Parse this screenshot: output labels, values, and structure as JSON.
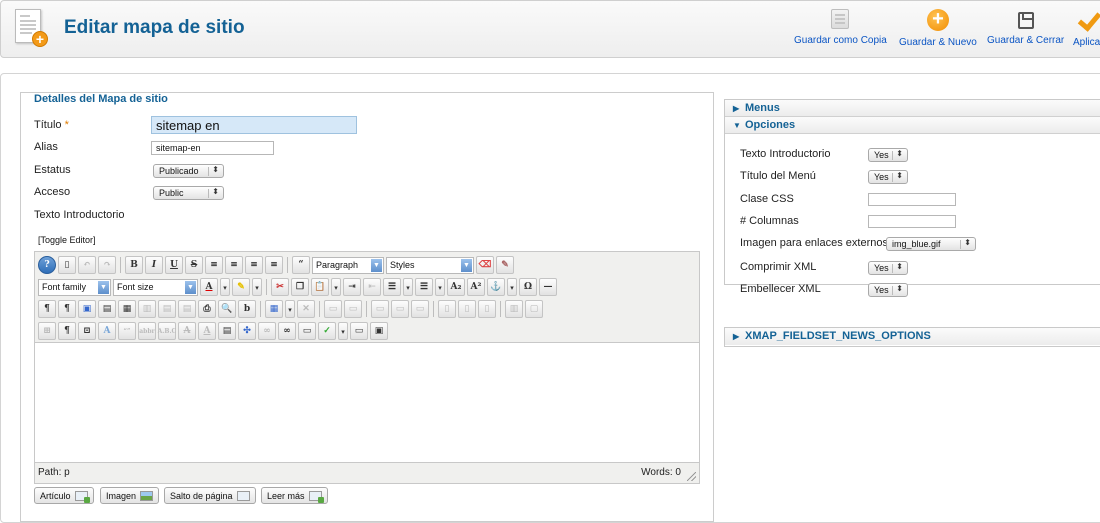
{
  "header": {
    "title": "Editar mapa de sitio",
    "buttons": [
      {
        "label": "Guardar como Copia",
        "icon": "copy-icon"
      },
      {
        "label": "Guardar & Nuevo",
        "icon": "plus-circle-icon"
      },
      {
        "label": "Guardar & Cerrar",
        "icon": "floppy-icon"
      },
      {
        "label": "Aplicar",
        "icon": "check-icon"
      }
    ]
  },
  "details": {
    "legend": "Detalles del Mapa de sitio",
    "title_label": "Título",
    "required_mark": "*",
    "title_value": "sitemap en",
    "alias_label": "Alias",
    "alias_value": "sitemap-en",
    "status_label": "Estatus",
    "status_value": "Publicado",
    "access_label": "Acceso",
    "access_value": "Public",
    "intro_label": "Texto Introductorio",
    "toggle_editor": "[Toggle Editor]"
  },
  "editor": {
    "format_select": "Paragraph",
    "styles_select": "Styles",
    "font_family_select": "Font family",
    "font_size_select": "Font size",
    "path_label": "Path: p",
    "words_label": "Words: 0"
  },
  "extra_buttons": [
    "Artículo",
    "Imagen",
    "Salto de página",
    "Leer más"
  ],
  "sidebar": {
    "menus_title": "Menus",
    "options_title": "Opciones",
    "news_title": "XMAP_FIELDSET_NEWS_OPTIONS",
    "options": {
      "intro_text_label": "Texto Introductorio",
      "intro_text_value": "Yes",
      "menu_title_label": "Título del Menú",
      "menu_title_value": "Yes",
      "css_class_label": "Clase CSS",
      "columns_label": "# Columnas",
      "external_image_label": "Imagen para enlaces externos",
      "external_image_value": "img_blue.gif",
      "compress_label": "Comprimir XML",
      "compress_value": "Yes",
      "beautify_label": "Embellecer XML",
      "beautify_value": "Yes"
    }
  },
  "colors": {
    "accent": "#146295",
    "link": "#0b55c4",
    "orange": "#f39a18"
  }
}
